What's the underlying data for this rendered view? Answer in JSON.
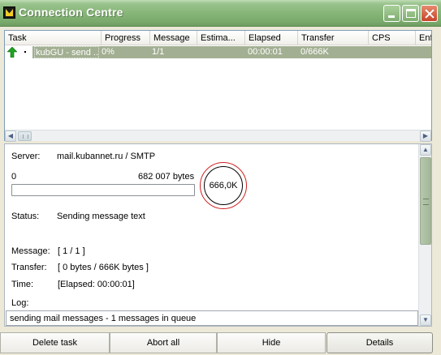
{
  "window": {
    "title": "Connection Centre"
  },
  "task_list": {
    "columns": [
      "Task",
      "Progress",
      "Message",
      "Estima...",
      "Elapsed",
      "Transfer",
      "CPS",
      "Enf"
    ],
    "rows": [
      {
        "task": "kubGU - send ...",
        "progress": "0%",
        "message": "1/1",
        "estimate": "",
        "elapsed": "00:00:01",
        "transfer": "0/666K",
        "cps": "",
        "extra": ""
      }
    ]
  },
  "details": {
    "server_label": "Server:",
    "server_value": "mail.kubannet.ru / SMTP",
    "progress_start": "0",
    "progress_total": "682 007 bytes",
    "progress_fraction": 0,
    "gauge_value": "666,0K",
    "status_label": "Status:",
    "status_value": "Sending message text",
    "message_label": "Message:",
    "message_value": "[ 1 / 1 ]",
    "transfer_label": "Transfer:",
    "transfer_value": "[ 0 bytes / 666K bytes ]",
    "time_label": "Time:",
    "time_value": "[Elapsed: 00:00:01]",
    "log_label": "Log:",
    "log_line": "sending mail messages - 1 messages in queue"
  },
  "buttons": {
    "delete_task": "Delete task",
    "abort_all": "Abort all",
    "hide": "Hide",
    "details": "Details"
  },
  "colors": {
    "title_bar": "#87b679",
    "row_highlight": "#a2af92",
    "gauge_ring": "#cf2020"
  },
  "icons": {
    "app": "app-logo-icon",
    "task_status": "upload-arrow-icon"
  }
}
